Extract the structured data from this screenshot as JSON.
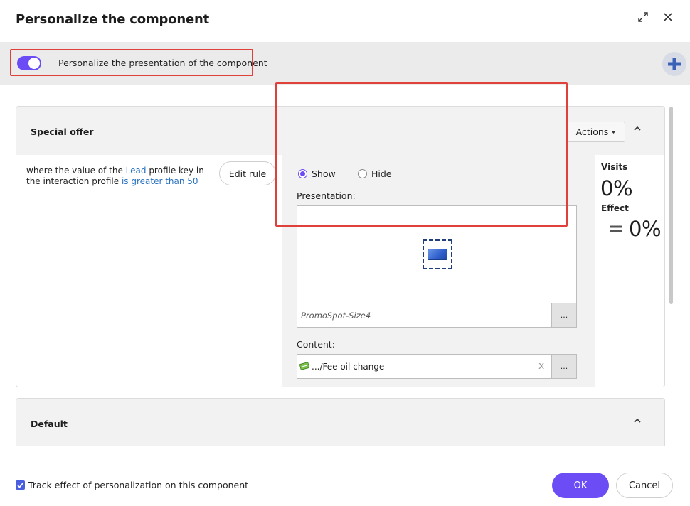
{
  "dialog": {
    "title": "Personalize the component",
    "expand_icon": "expand-icon",
    "close_icon": "close-icon"
  },
  "toggle": {
    "label": "Personalize the presentation of the component",
    "checked": true
  },
  "add_icon": "plus-icon",
  "special_offer": {
    "title": "Special offer",
    "actions_label": "Actions",
    "rule": {
      "pre": "where the value of the ",
      "key": "Lead",
      "mid": " profile key in the interaction profile ",
      "condition": "is greater than 50"
    },
    "edit_rule_label": "Edit rule",
    "show_label": "Show",
    "hide_label": "Hide",
    "selected_option": "Show",
    "presentation_label": "Presentation:",
    "presentation_value": "PromoSpot-Size4",
    "browse_label": "...",
    "content_label": "Content:",
    "content_value": ".../Fee oil change",
    "content_clear": "x",
    "content_browse_label": "...",
    "visits_label": "Visits",
    "visits_value": "0%",
    "effect_label": "Effect",
    "effect_sign": "=",
    "effect_value": "0%"
  },
  "default_panel": {
    "title": "Default"
  },
  "footer": {
    "track_label": "Track effect of personalization on this component",
    "track_checked": true,
    "ok_label": "OK",
    "cancel_label": "Cancel"
  },
  "colors": {
    "accent": "#6b4cf5",
    "highlight": "#e0403a",
    "link": "#2b73c2"
  }
}
